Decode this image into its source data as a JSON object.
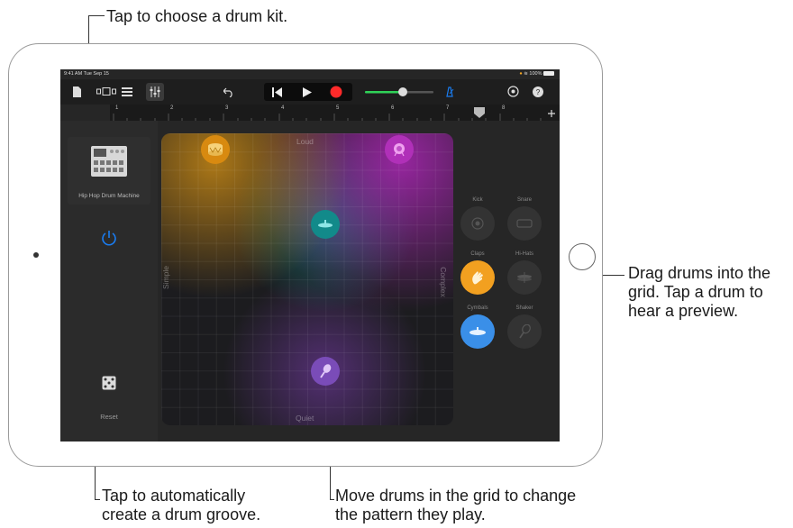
{
  "callouts": {
    "top": "Tap to choose a drum kit.",
    "right": "Drag drums into the grid. Tap a drum to hear a preview.",
    "bottom_left": "Tap to automatically create a drum groove.",
    "bottom_center": "Move drums in the grid to change the pattern they play."
  },
  "status_bar": {
    "time": "9:41 AM  Tue Sep 15",
    "battery": "100%"
  },
  "ruler": {
    "marks": [
      "1",
      "2",
      "3",
      "4",
      "5",
      "6",
      "7",
      "8"
    ]
  },
  "left_panel": {
    "kit_name": "Hip Hop Drum Machine",
    "reset_label": "Reset"
  },
  "grid": {
    "top_label": "Loud",
    "bottom_label": "Quiet",
    "left_label": "Simple",
    "right_label": "Complex"
  },
  "drum_pads": [
    {
      "label": "Kick"
    },
    {
      "label": "Snare"
    },
    {
      "label": "Claps"
    },
    {
      "label": "Hi-Hats"
    },
    {
      "label": "Cymbals"
    },
    {
      "label": "Shaker"
    }
  ],
  "colors": {
    "accent_blue": "#1a7cf0",
    "record_red": "#ff2a2a",
    "volume_green": "#30d158",
    "claps_orange": "#f2a020",
    "cymbals_blue": "#3a8fe8"
  }
}
